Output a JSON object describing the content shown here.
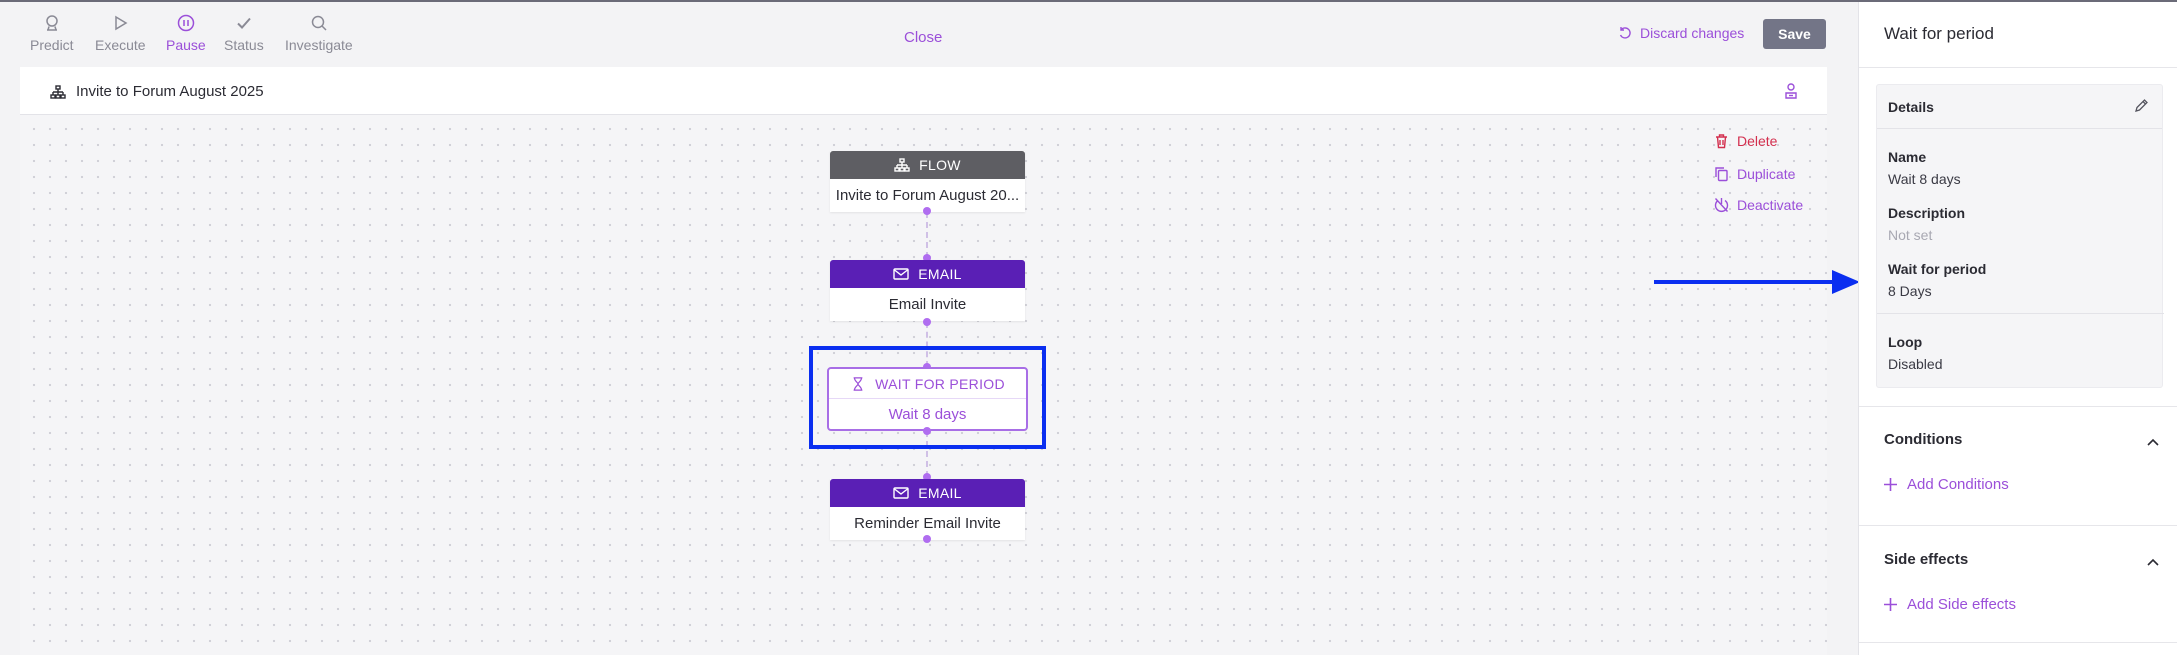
{
  "toolbar": {
    "tools": [
      {
        "label": "Predict",
        "icon": "predict-icon"
      },
      {
        "label": "Execute",
        "icon": "play-icon"
      },
      {
        "label": "Pause",
        "icon": "pause-icon",
        "active": true
      },
      {
        "label": "Status",
        "icon": "check-icon"
      },
      {
        "label": "Investigate",
        "icon": "search-icon"
      }
    ],
    "close_label": "Close",
    "discard_label": "Discard changes",
    "save_label": "Save"
  },
  "canvas": {
    "title": "Invite to Forum August 2025",
    "actions": {
      "delete": "Delete",
      "duplicate": "Duplicate",
      "deactivate": "Deactivate"
    },
    "nodes": [
      {
        "type": "FLOW",
        "label": "Invite to Forum August 20..."
      },
      {
        "type": "EMAIL",
        "label": "Email Invite"
      },
      {
        "type": "WAIT FOR PERIOD",
        "label": "Wait 8 days",
        "selected": true
      },
      {
        "type": "EMAIL",
        "label": "Reminder Email Invite"
      }
    ]
  },
  "side_panel": {
    "title": "Wait for period",
    "details": {
      "heading": "Details",
      "fields": [
        {
          "label": "Name",
          "value": "Wait 8 days"
        },
        {
          "label": "Description",
          "value": "Not set"
        },
        {
          "label": "Wait for period",
          "value": "8 Days"
        },
        {
          "label": "Loop",
          "value": "Disabled"
        }
      ]
    },
    "conditions": {
      "title": "Conditions",
      "add_label": "Add Conditions"
    },
    "side_effects": {
      "title": "Side effects",
      "add_label": "Add Side effects"
    }
  },
  "colors": {
    "accent": "#9b4fd9",
    "email_node": "#5a1fb5",
    "flow_node": "#5e5e63",
    "highlight": "#0a2ef0",
    "delete": "#d32f4e",
    "save_button": "#737587"
  }
}
